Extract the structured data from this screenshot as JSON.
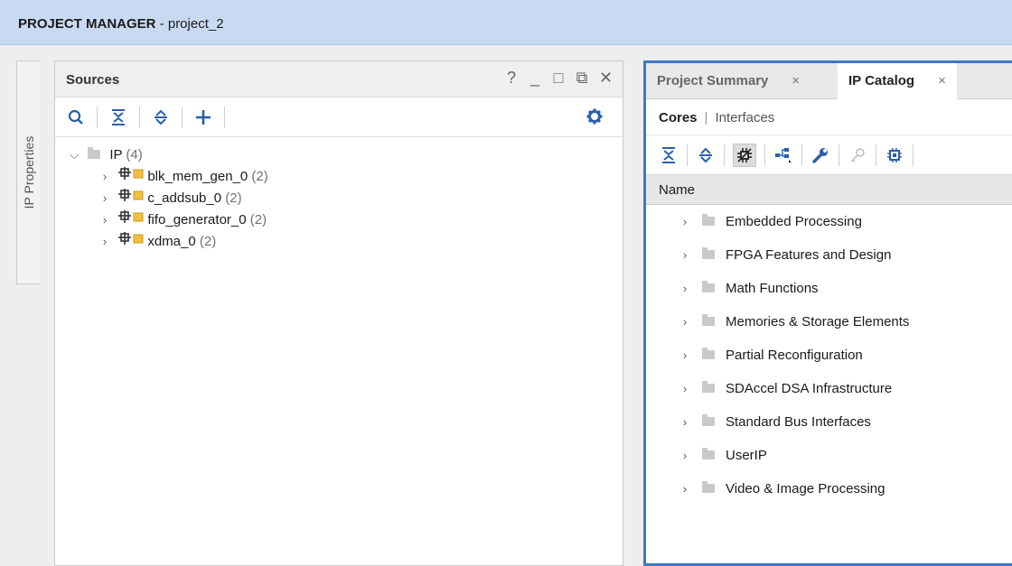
{
  "header": {
    "title_bold": "PROJECT MANAGER",
    "title_rest": " - project_2"
  },
  "side_tab": {
    "label": "IP Properties"
  },
  "sources": {
    "title": "Sources",
    "controls": [
      "?",
      "_",
      "□",
      "⧉",
      "✕"
    ],
    "tree": {
      "root": {
        "label": "IP",
        "count": "(4)"
      },
      "items": [
        {
          "label": "blk_mem_gen_0",
          "count": "(2)"
        },
        {
          "label": "c_addsub_0",
          "count": "(2)"
        },
        {
          "label": "fifo_generator_0",
          "count": "(2)"
        },
        {
          "label": "xdma_0",
          "count": "(2)"
        }
      ]
    }
  },
  "right": {
    "tabs": [
      {
        "label": "Project Summary",
        "close": "×",
        "active": false
      },
      {
        "label": "IP Catalog",
        "close": "×",
        "active": true
      }
    ],
    "subtabs": {
      "active": "Cores",
      "separator": "|",
      "inactive": "Interfaces"
    },
    "column_header": "Name",
    "categories": [
      "Embedded Processing",
      "FPGA Features and Design",
      "Math Functions",
      "Memories & Storage Elements",
      "Partial Reconfiguration",
      "SDAccel DSA Infrastructure",
      "Standard Bus Interfaces",
      "UserIP",
      "Video & Image Processing"
    ]
  },
  "colors": {
    "title_bar": "#c8daf2",
    "accent_border": "#3c78c8",
    "icon_blue": "#2a5fa8",
    "ip_yellow": "#f0c040"
  }
}
